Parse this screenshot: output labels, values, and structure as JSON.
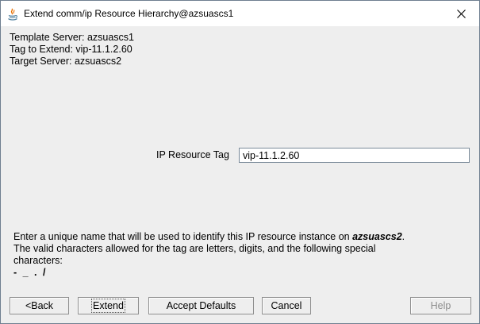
{
  "window": {
    "title": "Extend comm/ip Resource Hierarchy@azsuascs1"
  },
  "info": {
    "template_server": "Template Server: azsuascs1",
    "tag_to_extend": "Tag to Extend: vip-11.1.2.60",
    "target_server": "Target Server: azsuascs2"
  },
  "ip_tag": {
    "label": "IP Resource Tag",
    "value": "vip-11.1.2.60"
  },
  "help": {
    "line1_prefix": "Enter a unique name that will be used to identify this IP resource instance on ",
    "line1_server": "azsuascs2",
    "line1_suffix": ".",
    "line2": "The valid characters allowed for the tag are letters, digits, and the following special",
    "line3": "characters:",
    "chars": "- _ . /"
  },
  "buttons": {
    "back": "<Back",
    "extend": "Extend",
    "accept_defaults": "Accept Defaults",
    "cancel": "Cancel",
    "help": "Help"
  },
  "icons": {
    "app": "java-icon",
    "close": "close-icon"
  }
}
